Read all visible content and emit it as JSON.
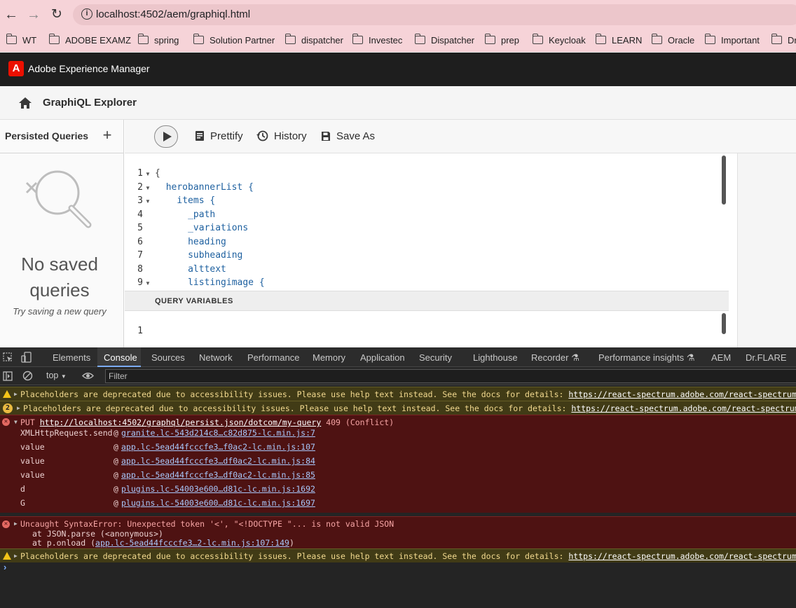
{
  "browser": {
    "url_host": "localhost",
    "url_rest": ":4502/aem/graphiql.html",
    "bookmarks": [
      "WT",
      "ADOBE EXAMZ",
      "spring",
      "Solution Partner",
      "dispatcher",
      "Investec",
      "Dispatcher",
      "prep",
      "Keycloak",
      "LEARN",
      "Oracle",
      "Important",
      "Dr"
    ]
  },
  "aem": {
    "product_title": "Adobe Experience Manager",
    "page_title": "GraphiQL Explorer"
  },
  "left_panel": {
    "title": "Persisted Queries",
    "add_label": "+",
    "empty_title": "No saved queries",
    "empty_sub": "Try saving a new query"
  },
  "toolbar": {
    "prettify": "Prettify",
    "history": "History",
    "save_as": "Save As"
  },
  "editor": {
    "lines": [
      {
        "n": "1",
        "text": "{",
        "indent": 0,
        "fold": true
      },
      {
        "n": "2",
        "text": "herobannerList {",
        "indent": 1,
        "fold": true
      },
      {
        "n": "3",
        "text": "items {",
        "indent": 2,
        "fold": true
      },
      {
        "n": "4",
        "text": "_path",
        "indent": 3,
        "fold": false
      },
      {
        "n": "5",
        "text": "_variations",
        "indent": 3,
        "fold": false
      },
      {
        "n": "6",
        "text": "heading",
        "indent": 3,
        "fold": false
      },
      {
        "n": "7",
        "text": "subheading",
        "indent": 3,
        "fold": false
      },
      {
        "n": "8",
        "text": "alttext",
        "indent": 3,
        "fold": false
      },
      {
        "n": "9",
        "text": "listingimage {",
        "indent": 3,
        "fold": true
      }
    ],
    "query_variables_label": "QUERY VARIABLES",
    "qv_line": "1"
  },
  "devtools": {
    "tabs": [
      "Elements",
      "Console",
      "Sources",
      "Network",
      "Performance",
      "Memory",
      "Application",
      "Security",
      "Lighthouse",
      "Recorder ⚗",
      "Performance insights ⚗",
      "AEM",
      "Dr.FLARE"
    ],
    "active_tab": "Console",
    "context": "top",
    "filter_placeholder": "Filter",
    "warn_text": "Placeholders are deprecated due to accessibility issues. Please use help text instead. See the docs for details: ",
    "warn_link": "https://react-spectrum.adobe.com/react-spectrum/TextField",
    "warn_repeat_count": "2",
    "put_error": {
      "method": "PUT ",
      "url": "http://localhost:4502/graphql/persist.json/dotcom/my-query",
      "status": " 409 (Conflict)"
    },
    "stack": [
      {
        "fn": "XMLHttpRequest.send",
        "src": "granite.lc-543d214c8…c82d875-lc.min.js:7"
      },
      {
        "fn": "value",
        "src": "app.lc-5ead44fcccfe3…f0ac2-lc.min.js:107"
      },
      {
        "fn": "value",
        "src": "app.lc-5ead44fcccfe3…df0ac2-lc.min.js:84"
      },
      {
        "fn": "value",
        "src": "app.lc-5ead44fcccfe3…df0ac2-lc.min.js:85"
      },
      {
        "fn": "d",
        "src": "plugins.lc-54003e600…d81c-lc.min.js:1692"
      },
      {
        "fn": "G",
        "src": "plugins.lc-54003e600…d81c-lc.min.js:1697"
      }
    ],
    "syntax_error": "Uncaught SyntaxError: Unexpected token '<', \"<!DOCTYPE \"... is not valid JSON",
    "syntax_at1": "at JSON.parse (<anonymous>)",
    "syntax_at2_pre": "at p.onload (",
    "syntax_at2_link": "app.lc-5ead44fcccfe3…2-lc.min.js:107:149",
    "syntax_at2_post": ")",
    "prompt": "›"
  },
  "colors": {
    "browser_bar": "#f6d3d8",
    "aem_header": "#1e1e1e",
    "aem_logo": "#eb1000",
    "devtools_bg": "#242424",
    "warning_bg": "#413b16",
    "error_bg": "#4e1212"
  }
}
